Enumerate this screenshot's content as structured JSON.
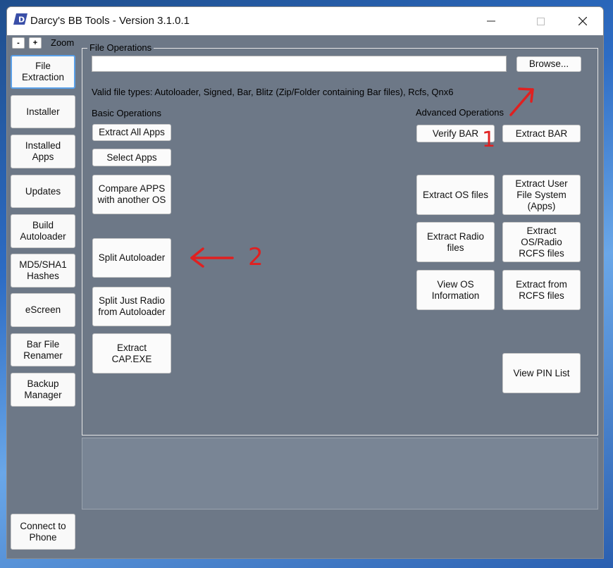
{
  "window": {
    "title": "Darcy's BB Tools - Version 3.1.0.1",
    "controls": {
      "minimize": "—",
      "maximize": "☐",
      "close": "✕"
    }
  },
  "zoom": {
    "minus": "-",
    "plus": "+",
    "label": "Zoom"
  },
  "sidebar": {
    "items": [
      {
        "label": "File\nExtraction",
        "active": true
      },
      {
        "label": "Installer"
      },
      {
        "label": "Installed\nApps"
      },
      {
        "label": "Updates"
      },
      {
        "label": "Build\nAutoloader"
      },
      {
        "label": "MD5/SHA1\nHashes"
      },
      {
        "label": "eScreen"
      },
      {
        "label": "Bar File\nRenamer"
      },
      {
        "label": "Backup\nManager"
      }
    ],
    "connect_label": "Connect to\nPhone"
  },
  "file_operations": {
    "group_title": "File Operations",
    "path_value": "",
    "browse_label": "Browse...",
    "valid_types": "Valid file types:  Autoloader, Signed, Bar, Blitz (Zip/Folder containing Bar files), Rcfs, Qnx6"
  },
  "basic": {
    "heading": "Basic Operations",
    "buttons": [
      "Extract All Apps",
      "Select Apps",
      "Compare APPS\nwith another OS",
      "Split Autoloader",
      "Split Just Radio\nfrom Autoloader",
      "Extract\nCAP.EXE"
    ]
  },
  "advanced": {
    "heading": "Advanced Operations",
    "buttons": [
      "Verify BAR",
      "Extract BAR",
      "Extract OS files",
      "Extract User\nFile System\n(Apps)",
      "Extract Radio\nfiles",
      "Extract\nOS/Radio\nRCFS files",
      "View OS\nInformation",
      "Extract from\nRCFS files",
      "View PIN List"
    ]
  },
  "log": {
    "text": ""
  },
  "annotations": {
    "mark_1": "1",
    "mark_2": "2",
    "color": "#e02020"
  },
  "colors": {
    "client_bg": "#6d7887",
    "accent": "#5aa0e8"
  }
}
